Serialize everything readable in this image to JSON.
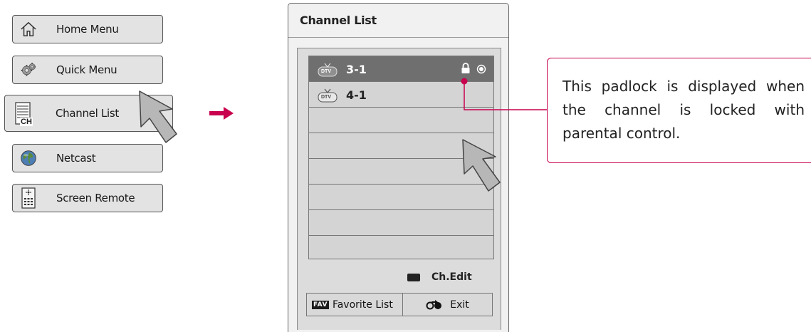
{
  "menu": {
    "items": [
      {
        "label": "Home Menu",
        "icon": "home-icon"
      },
      {
        "label": "Quick Menu",
        "icon": "gear-icon"
      },
      {
        "label": "Channel List",
        "icon": "channel-list-icon",
        "active": true
      },
      {
        "label": "Netcast",
        "icon": "globe-icon"
      },
      {
        "label": "Screen Remote",
        "icon": "remote-icon"
      }
    ],
    "channel_icon_text": "CH"
  },
  "panel": {
    "title": "Channel List",
    "channels": [
      {
        "number": "3-1",
        "badge": "DTV",
        "locked": true,
        "selected": true
      },
      {
        "number": "4-1",
        "badge": "DTV",
        "locked": false,
        "selected": false
      }
    ],
    "ch_edit_label": "Ch.Edit",
    "favorite_badge": "FAV",
    "favorite_label": "Favorite List",
    "exit_label": "Exit"
  },
  "callout": {
    "text": "This padlock is displayed when the channel is locked with parental control."
  },
  "colors": {
    "accent": "#c8004e",
    "selected_row": "#6f6f6f",
    "menu_bg": "#e3e3e3"
  }
}
